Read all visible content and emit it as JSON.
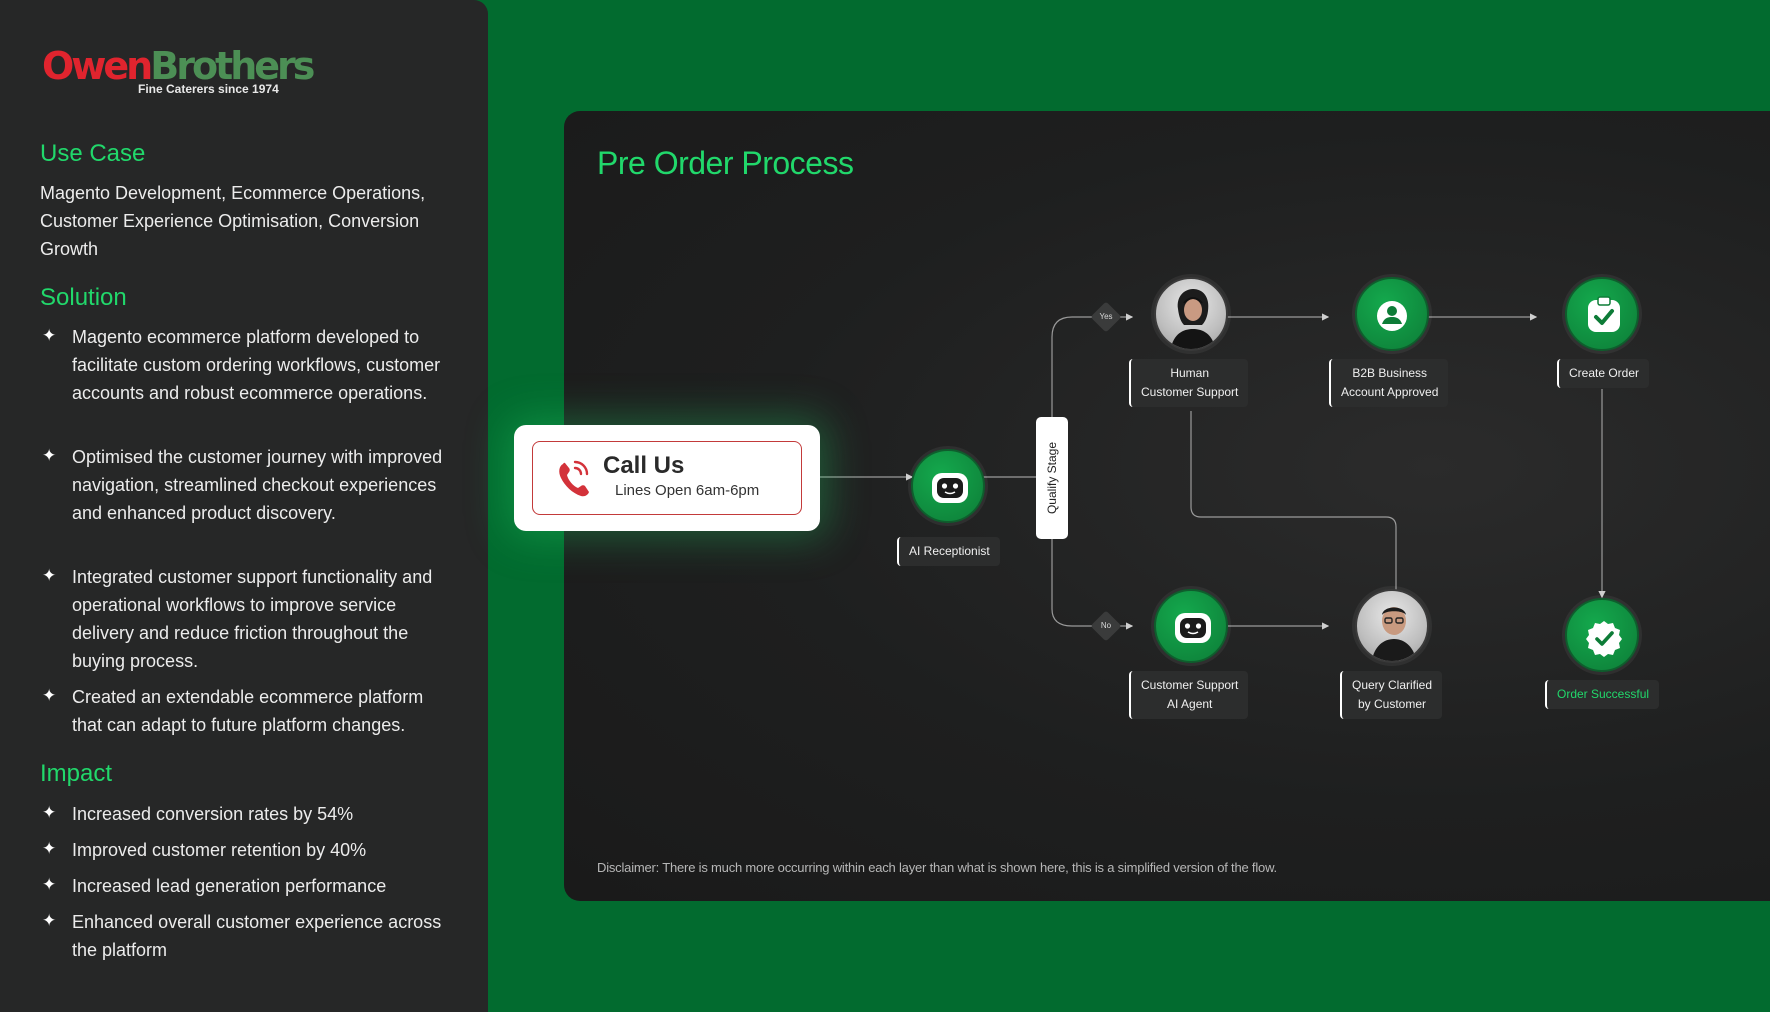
{
  "brand": {
    "name_part1": "Owen",
    "name_part2": "Brothers",
    "tagline": "Fine Caterers since 1974"
  },
  "sidebar": {
    "use_case": {
      "title": "Use Case",
      "text": "Magento Development, Ecommerce Operations, Customer Experience Optimisation, Conversion Growth"
    },
    "solution": {
      "title": "Solution",
      "items": [
        "Magento ecommerce platform developed to facilitate custom ordering workflows, customer accounts and robust ecommerce operations.",
        "Optimised the customer journey with improved navigation, streamlined checkout experiences and enhanced product discovery.",
        "Integrated customer support functionality and operational workflows to improve service delivery and reduce friction throughout the buying process.",
        "Created an extendable ecommerce platform that can adapt to future platform changes."
      ]
    },
    "impact": {
      "title": "Impact",
      "items": [
        "Increased conversion rates by 54%",
        "Improved customer retention by 40%",
        "Increased lead generation performance",
        "Enhanced overall customer experience across the platform"
      ]
    },
    "bullet_glyph": "✦"
  },
  "diagram": {
    "title": "Pre Order Process",
    "call_card": {
      "title": "Call Us",
      "subtitle": "Lines Open 6am-6pm"
    },
    "nodes": {
      "ai_receptionist": "AI Receptionist",
      "qualify_stage": "Qualify Stage",
      "yes": "Yes",
      "no": "No",
      "human_support_line1": "Human",
      "human_support_line2": "Customer Support",
      "b2b_line1": "B2B Business",
      "b2b_line2": "Account Approved",
      "create_order": "Create Order",
      "ai_agent_line1": "Customer Support",
      "ai_agent_line2": "AI Agent",
      "query_line1": "Query Clarified",
      "query_line2": "by Customer",
      "order_successful": "Order Successful"
    },
    "disclaimer": "Disclaimer: There is much more occurring within each layer than what is shown here, this is a simplified version of the flow."
  },
  "colors": {
    "background_green": "#026b2f",
    "accent_green": "#21d86b",
    "sidebar": "#262727",
    "panel": "#1e1f1f",
    "brand_red": "#e0242e"
  }
}
